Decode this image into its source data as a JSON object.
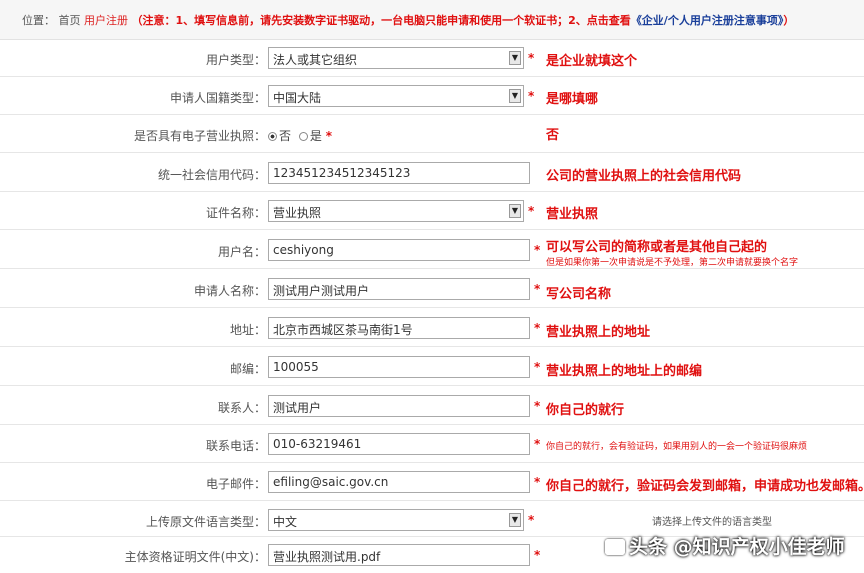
{
  "breadcrumb": {
    "position_label": "位置：",
    "home": "首页",
    "current": "用户注册",
    "notice_prefix": "（注意：1、填写信息前，请先安装数字证书驱动，一台电脑只能申请和使用一个软证书；2、点击查看",
    "notice_link": "《企业/个人用户注册注意事项》",
    "notice_suffix": "）"
  },
  "form": {
    "user_type": {
      "label": "用户类型：",
      "value": "法人或其它组织",
      "note": "是企业就填这个"
    },
    "nationality": {
      "label": "申请人国籍类型：",
      "value": "中国大陆",
      "note": "是哪填哪"
    },
    "e_license": {
      "label": "是否具有电子营业执照：",
      "option_no": "否",
      "option_yes": "是",
      "selected": "否",
      "note": "否"
    },
    "credit_code": {
      "label": "统一社会信用代码：",
      "value": "123451234512345123",
      "note": "公司的营业执照上的社会信用代码"
    },
    "cert_name": {
      "label": "证件名称：",
      "value": "营业执照",
      "note": "营业执照"
    },
    "username": {
      "label": "用户名：",
      "value": "ceshiyong",
      "note": "可以写公司的简称或者是其他自己起的",
      "note_small": "但是如果你第一次申请说是不予处理，第二次申请就要换个名字"
    },
    "applicant_name": {
      "label": "申请人名称：",
      "value": "测试用户测试用户",
      "note": "写公司名称"
    },
    "address": {
      "label": "地址：",
      "value": "北京市西城区茶马南街1号",
      "note": "营业执照上的地址"
    },
    "postcode": {
      "label": "邮编：",
      "value": "100055",
      "note": "营业执照上的地址上的邮编"
    },
    "contact": {
      "label": "联系人：",
      "value": "测试用户",
      "note": "你自己的就行"
    },
    "phone": {
      "label": "联系电话：",
      "value": "010-63219461",
      "note_small": "你自己的就行，会有验证码，如果用别人的一会一个验证码很麻烦"
    },
    "email": {
      "label": "电子邮件：",
      "value": "efiling@saic.gov.cn",
      "note": "你自己的就行，验证码会发到邮箱，申请成功也发邮箱。"
    },
    "upload_lang": {
      "label": "上传原文件语言类型：",
      "value": "中文",
      "hint": "请选择上传文件的语言类型"
    },
    "subject_doc": {
      "label": "主体资格证明文件(中文)：",
      "value": "营业执照测试用.pdf"
    }
  },
  "required_mark": "*",
  "watermark": "头条 @知识产权小佳老师",
  "colors": {
    "accent_red": "#e01010",
    "link_blue": "#1a3f9a"
  }
}
